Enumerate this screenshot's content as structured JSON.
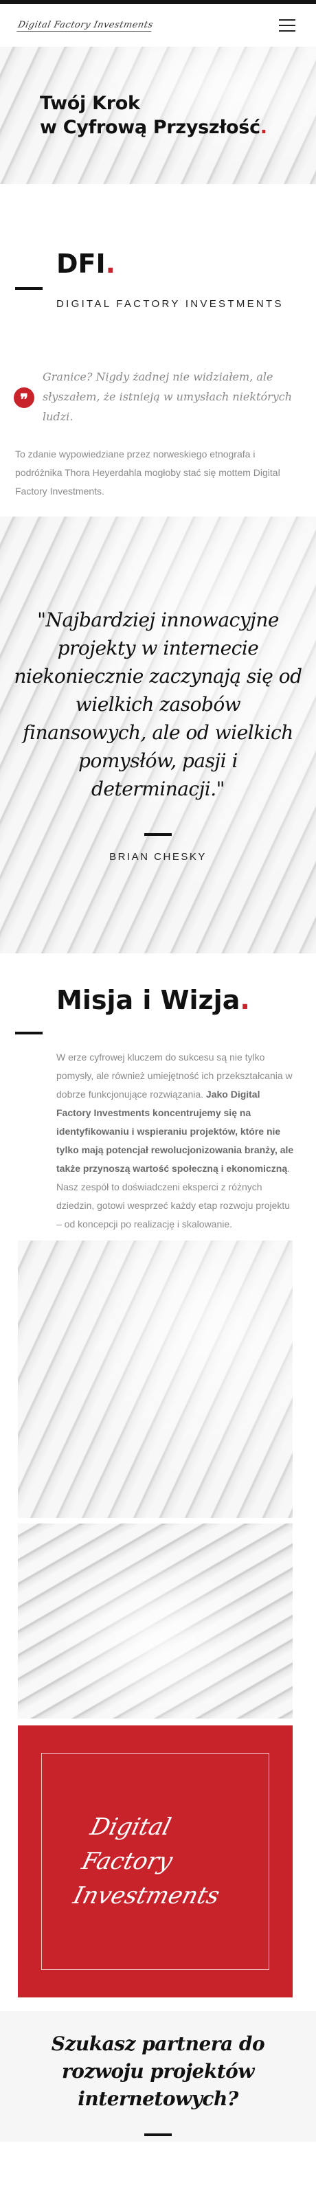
{
  "nav": {
    "logo_text": "Digital Factory Investments",
    "menu_icon": "hamburger-menu-icon"
  },
  "hero": {
    "line1": "Twój Krok",
    "line2": "w Cyfrową Przyszłość",
    "dot": "."
  },
  "dfi": {
    "title": "DFI",
    "dot": ".",
    "subtitle": "DIGITAL FACTORY INVESTMENTS"
  },
  "quote": {
    "icon": "quote-icon",
    "text": "Granice? Nigdy żadnej nie widziałem, ale słyszałem, że istnieją w umysłach niektórych ludzi.",
    "note": "To zdanie wypowiedziane przez norweskiego etnografa i podróżnika Thora Heyerdahla mogłoby stać się mottem Digital Factory Investments."
  },
  "chesky": {
    "quote": "\"Najbardziej innowacyjne projekty w internecie niekoniecznie zaczynają się od wielkich zasobów finansowych, ale od wielkich pomysłów, pasji i determinacji.\"",
    "author": "BRIAN CHESKY"
  },
  "misja": {
    "title": "Misja i Wizja",
    "dot": ".",
    "text_1": "W erze cyfrowej kluczem do sukcesu są nie tylko pomysły, ale również umiejętność ich przekształcania w dobrze funkcjonujące rozwiązania. ",
    "text_bold": "Jako Digital Factory Investments koncentrujemy się na identyfikowaniu i wspieraniu projektów, które nie tylko mają potencjał rewolucjonizowania branży, ale także przynoszą wartość społeczną i ekonomiczną",
    "text_2": ". Nasz zespół to doświadczeni eksperci z różnych dziedzin, gotowi wesprzeć każdy etap rozwoju projektu – od koncepcji po realizację i skalowanie."
  },
  "redbox": {
    "logo_line1": "Digital",
    "logo_line2": "Factory",
    "logo_line3": "Investments"
  },
  "partner": {
    "title": "Szukasz partnera do rozwoju projektów internetowych?"
  },
  "colors": {
    "accent": "#c8222b",
    "text_dark": "#111111",
    "text_muted": "#8a8a8a"
  }
}
